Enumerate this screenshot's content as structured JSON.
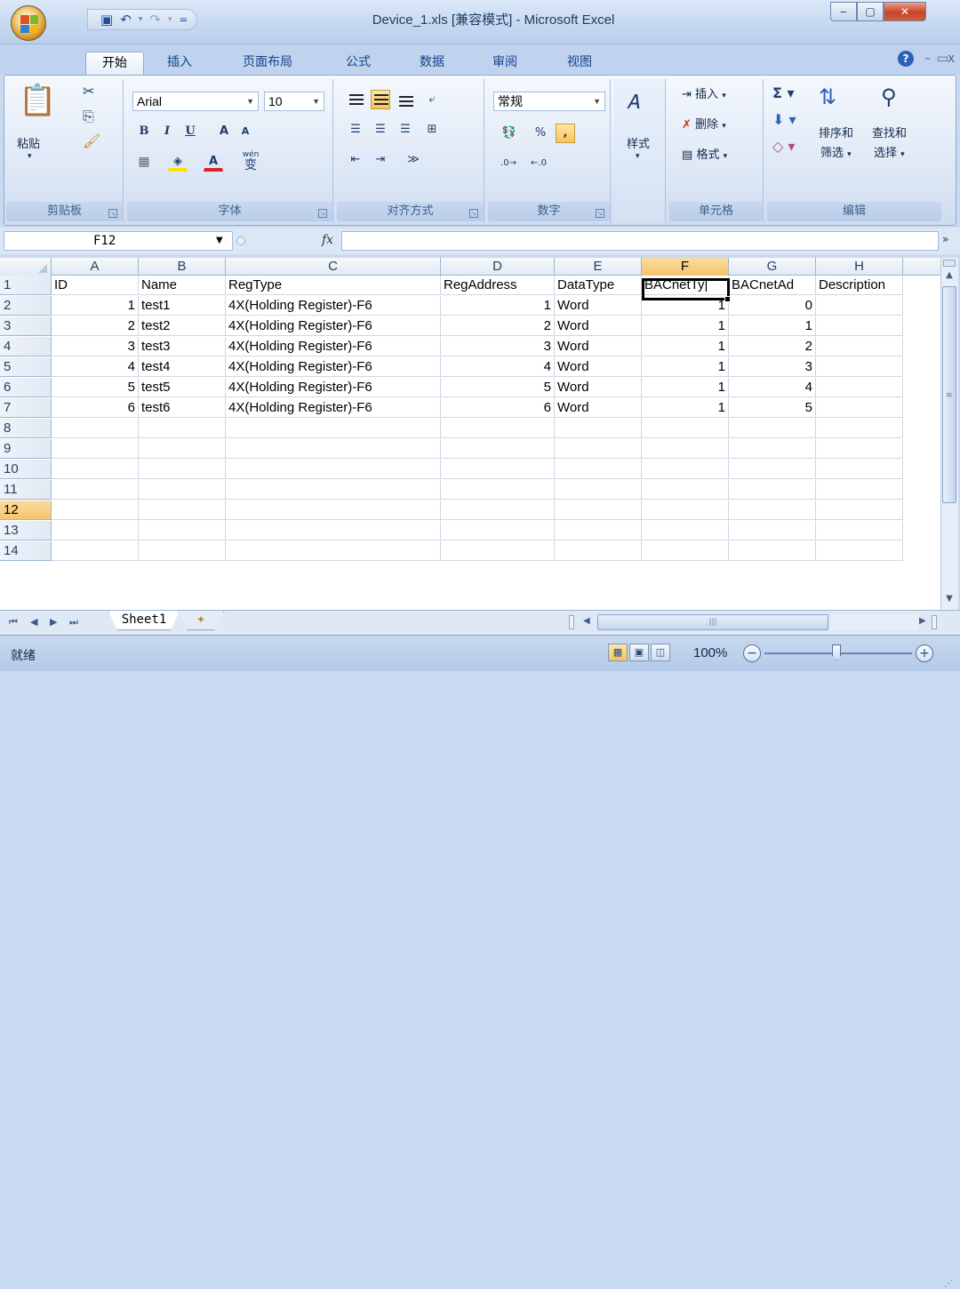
{
  "window": {
    "title": "Device_1.xls  [兼容模式] - Microsoft Excel"
  },
  "ribbon_tabs": [
    "开始",
    "插入",
    "页面布局",
    "公式",
    "数据",
    "审阅",
    "视图"
  ],
  "clipboard": {
    "paste_label": "粘贴",
    "group_label": "剪贴板"
  },
  "font": {
    "name": "Arial",
    "size": "10",
    "bold": "B",
    "italic": "I",
    "underline": "U",
    "grow": "A",
    "shrink": "A",
    "phonetic": "wén",
    "phonetic_char": "变",
    "group_label": "字体"
  },
  "alignment": {
    "group_label": "对齐方式"
  },
  "number": {
    "format": "常规",
    "percent": "%",
    "comma": ",",
    "group_label": "数字"
  },
  "styles": {
    "label": "样式"
  },
  "cells_group": {
    "insert": "插入",
    "delete": "删除",
    "format": "格式",
    "group_label": "单元格"
  },
  "editing": {
    "sort_filter_line1": "排序和",
    "sort_filter_line2": "筛选",
    "find_select_line1": "查找和",
    "find_select_line2": "选择",
    "group_label": "编辑"
  },
  "formula_bar": {
    "name_box": "F12",
    "fx": "fx",
    "formula": ""
  },
  "columns": [
    "A",
    "B",
    "C",
    "D",
    "E",
    "F",
    "G",
    "H"
  ],
  "selected_column": "F",
  "selected_row": "12",
  "sheet": {
    "header": [
      "ID",
      "Name",
      "RegType",
      "RegAddress",
      "DataType",
      "BACnetTy|",
      "BACnetAd",
      "Description"
    ],
    "rows": [
      [
        "1",
        "test1",
        "4X(Holding Register)-F6",
        "1",
        "Word",
        "1",
        "0",
        ""
      ],
      [
        "2",
        "test2",
        "4X(Holding Register)-F6",
        "2",
        "Word",
        "1",
        "1",
        ""
      ],
      [
        "3",
        "test3",
        "4X(Holding Register)-F6",
        "3",
        "Word",
        "1",
        "2",
        ""
      ],
      [
        "4",
        "test4",
        "4X(Holding Register)-F6",
        "4",
        "Word",
        "1",
        "3",
        ""
      ],
      [
        "5",
        "test5",
        "4X(Holding Register)-F6",
        "5",
        "Word",
        "1",
        "4",
        ""
      ],
      [
        "6",
        "test6",
        "4X(Holding Register)-F6",
        "6",
        "Word",
        "1",
        "5",
        ""
      ]
    ],
    "row_numbers": [
      "1",
      "2",
      "3",
      "4",
      "5",
      "6",
      "7",
      "8",
      "9",
      "10",
      "11",
      "12",
      "13",
      "14"
    ]
  },
  "sheet_tabs": {
    "active": "Sheet1"
  },
  "status": {
    "text": "就绪",
    "zoom": "100%"
  }
}
